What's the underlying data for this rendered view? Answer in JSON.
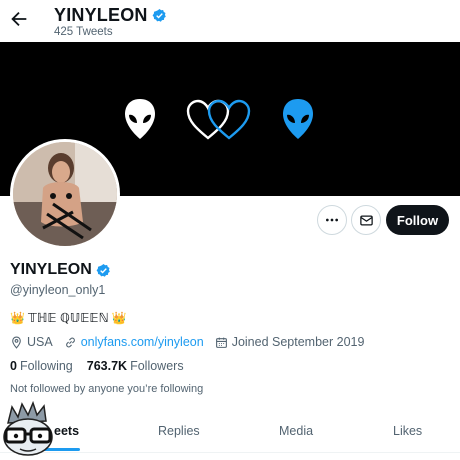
{
  "header": {
    "name": "YINYLEON",
    "tweet_count": "425 Tweets"
  },
  "banner": {
    "icons": [
      "alien-icon-white",
      "heart-outline-white-icon",
      "heart-outline-blue-icon",
      "alien-icon-blue"
    ],
    "colors": {
      "background": "#000000",
      "white": "#ffffff",
      "blue": "#1d9bf0"
    }
  },
  "actions": {
    "follow_label": "Follow"
  },
  "profile": {
    "display_name": "YINYLEON",
    "handle": "@yinyleon_only1",
    "bio_text": "𝕋ℍ𝔼 ℚ𝕌𝔼𝔼ℕ",
    "bio_emoji_left": "👑",
    "bio_emoji_right": "👑",
    "location": "USA",
    "link": "onlyfans.com/yinyleon",
    "joined": "Joined September 2019",
    "following_count": "0",
    "following_label": "Following",
    "followers_count": "763.7K",
    "followers_label": "Followers",
    "not_followed": "Not followed by anyone you’re following"
  },
  "tabs": [
    {
      "label": "Tweets",
      "active": true
    },
    {
      "label": "Replies",
      "active": false
    },
    {
      "label": "Media",
      "active": false
    },
    {
      "label": "Likes",
      "active": false
    }
  ],
  "tab_visible_text": "eets",
  "accent_color": "#1d9bf0"
}
